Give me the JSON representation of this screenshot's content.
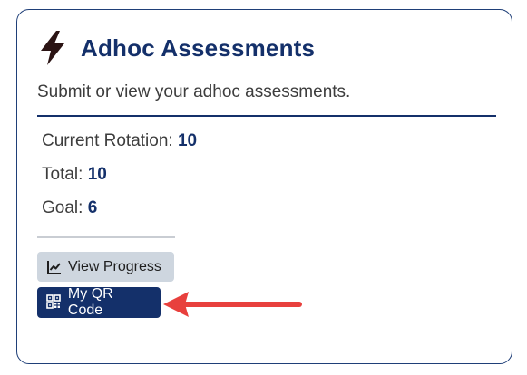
{
  "card": {
    "title": "Adhoc Assessments",
    "subtitle": "Submit or view your adhoc assessments.",
    "icon": "lightning-bolt-icon"
  },
  "stats": [
    {
      "label": "Current Rotation: ",
      "value": "10"
    },
    {
      "label": "Total: ",
      "value": "10"
    },
    {
      "label": "Goal: ",
      "value": "6"
    }
  ],
  "buttons": {
    "view_progress": {
      "label": "View Progress",
      "icon": "line-chart-icon"
    },
    "my_qr_code": {
      "label": "My QR Code",
      "icon": "qr-code-icon"
    }
  },
  "annotation": {
    "icon": "red-arrow-icon",
    "color": "#e8403d"
  },
  "colors": {
    "primary": "#14306a",
    "secondary_button": "#ced6df",
    "bolt": "#2b1414"
  }
}
